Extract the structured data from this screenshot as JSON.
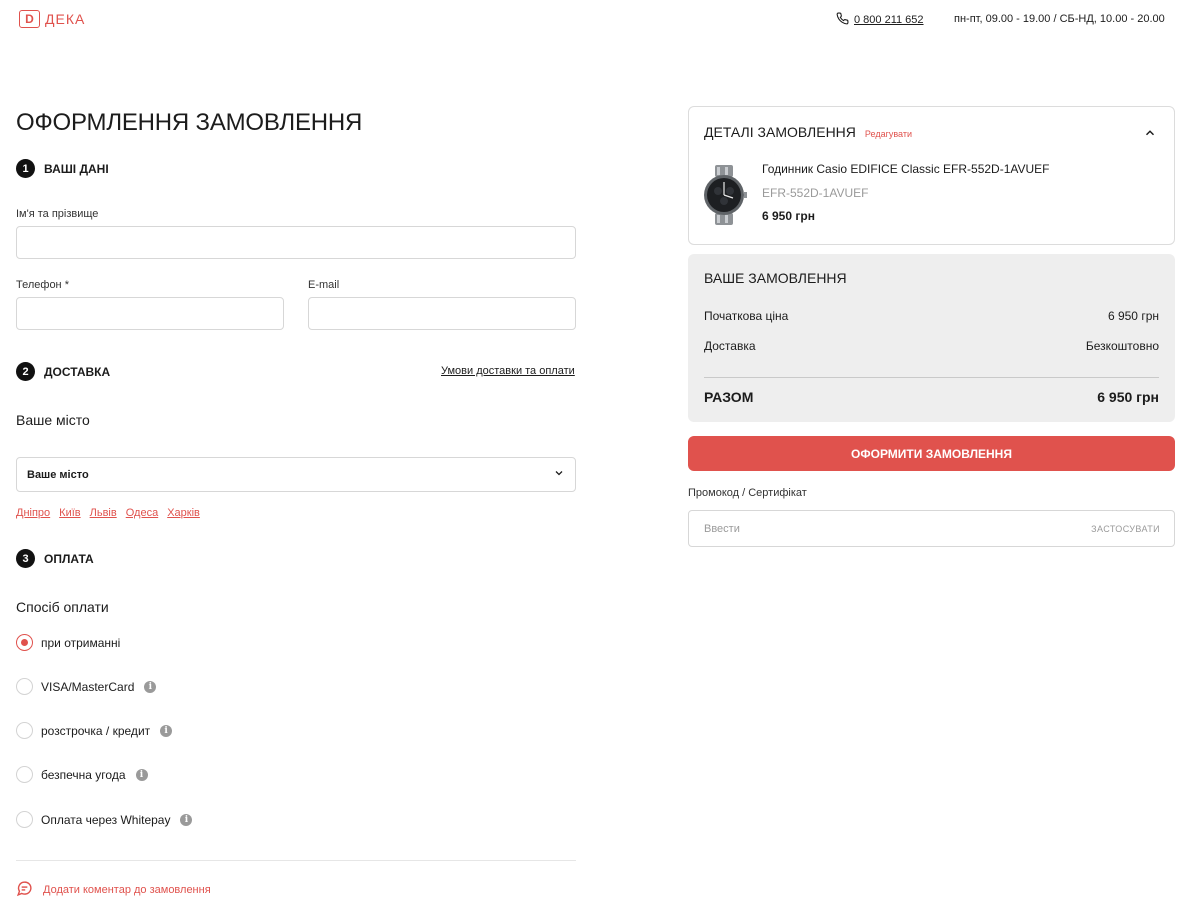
{
  "header": {
    "logo_mark": "D",
    "logo_text": "ДЕКА",
    "phone": "0 800 211 652",
    "hours": "пн-пт, 09.00 - 19.00 / СБ-НД, 10.00 - 20.00"
  },
  "page_title": "ОФОРМЛЕННЯ ЗАМОВЛЕННЯ",
  "personal": {
    "step_number": "1",
    "title": "ВАШІ ДАНІ",
    "name_label": "Ім'я та прізвище",
    "name_value": "",
    "phone_label": "Телефон *",
    "phone_value": "",
    "email_label": "E-mail",
    "email_value": ""
  },
  "delivery": {
    "step_number": "2",
    "title": "ДОСТАВКА",
    "terms_link": "Умови доставки та оплати",
    "city_title": "Ваше місто",
    "city_select": "Ваше місто",
    "cities": [
      "Дніпро",
      "Київ",
      "Львів",
      "Одеса",
      "Харків"
    ]
  },
  "payment": {
    "step_number": "3",
    "title": "ОПЛАТА",
    "method_title": "Спосіб оплати",
    "options": [
      {
        "label": "при отриманні",
        "selected": true,
        "info": false
      },
      {
        "label": "VISA/MasterCard",
        "selected": false,
        "info": true
      },
      {
        "label": "розстрочка / кредит",
        "selected": false,
        "info": true
      },
      {
        "label": "безпечна угода",
        "selected": false,
        "info": true
      },
      {
        "label": "Оплата через Whitepay",
        "selected": false,
        "info": true
      }
    ]
  },
  "comment_link": "Додати коментар до замовлення",
  "order_details": {
    "title": "ДЕТАЛІ ЗАМОВЛЕННЯ",
    "edit": "Редагувати",
    "product": {
      "name": "Годинник Casio EDIFICE Classic EFR-552D-1AVUEF",
      "sku": "EFR-552D-1AVUEF",
      "price": "6 950 грн"
    }
  },
  "summary": {
    "title": "ВАШЕ ЗАМОВЛЕННЯ",
    "initial_price_label": "Початкова ціна",
    "initial_price": "6 950 грн",
    "delivery_label": "Доставка",
    "delivery_value": "Безкоштовно",
    "total_label": "РАЗОМ",
    "total_value": "6 950 грн"
  },
  "order_button": "ОФОРМИТИ ЗАМОВЛЕННЯ",
  "promo": {
    "label": "Промокод / Сертифікат",
    "placeholder": "Ввести",
    "apply": "ЗАСТОСУВАТИ"
  },
  "colors": {
    "accent": "#e0524d",
    "text": "#1c1c1c",
    "muted": "#9a9a9a",
    "summary_bg": "#eeeeee",
    "border": "#d7d7d7"
  }
}
